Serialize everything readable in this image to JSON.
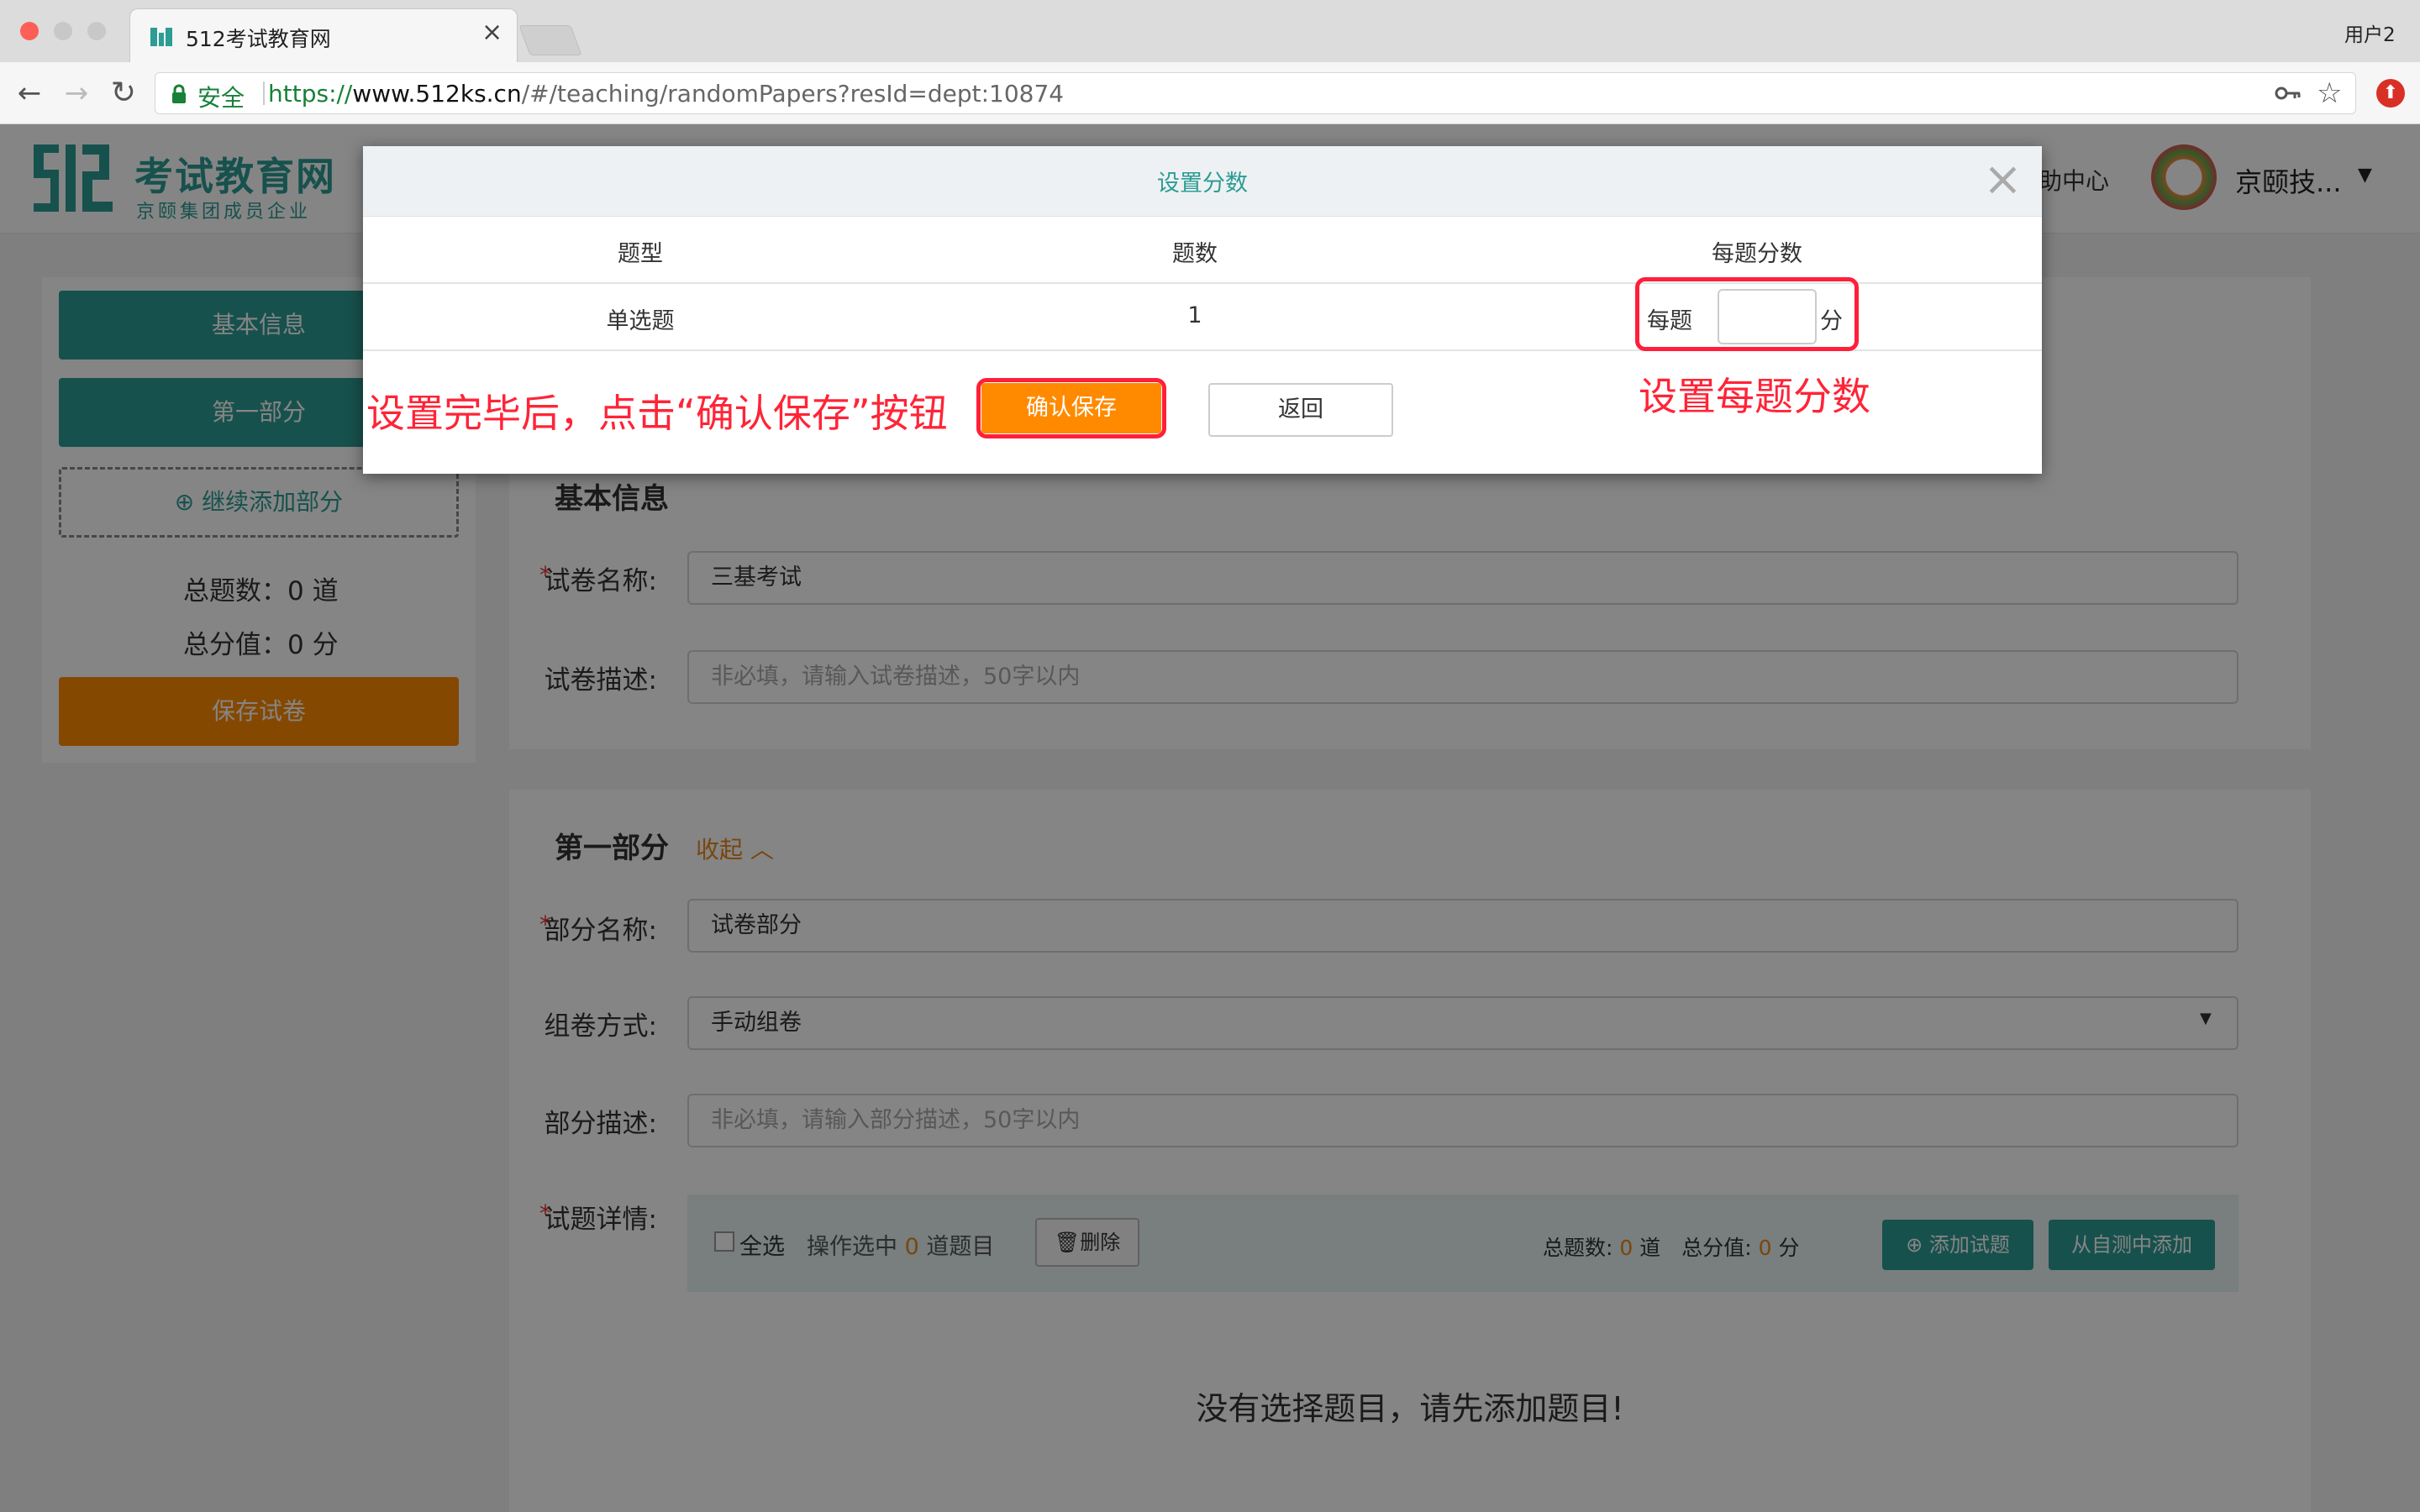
{
  "browser": {
    "tab_title": "512考试教育网",
    "tab_close": "×",
    "profile": "用户2",
    "url_secure": "安全",
    "url_scheme": "https://",
    "url_host": "www.512ks.cn",
    "url_path": "/#/teaching/randomPapers?resId=dept:10874"
  },
  "header": {
    "logo_mark": "512",
    "logo_title": "考试教育网",
    "logo_subtitle": "京颐集团成员企业",
    "help": "帮助中心",
    "user": "京颐技..."
  },
  "sidebar": {
    "basic_info": "基本信息",
    "part1": "第一部分",
    "add_part": "继续添加部分",
    "total_count_label": "总题数：",
    "total_count": "0",
    "total_count_unit": "道",
    "total_score_label": "总分值：",
    "total_score": "0",
    "total_score_unit": "分",
    "save_paper": "保存试卷"
  },
  "basic": {
    "section_title": "基本信息",
    "name_label": "试卷名称:",
    "name_value": "三基考试",
    "desc_label": "试卷描述:",
    "desc_placeholder": "非必填，请输入试卷描述，50字以内"
  },
  "part": {
    "section_title": "第一部分",
    "collapse": "收起",
    "name_label": "部分名称:",
    "name_value": "试卷部分",
    "mode_label": "组卷方式:",
    "mode_value": "手动组卷",
    "desc_label": "部分描述:",
    "desc_placeholder": "非必填，请输入部分描述，50字以内",
    "detail_label": "试题详情:",
    "select_all": "全选",
    "op_selected": "操作选中",
    "selected_count": "0",
    "selected_unit": "道题目",
    "delete": "删除",
    "total_count_label": "总题数:",
    "total_count": "0",
    "total_count_unit": "道",
    "total_score_label": "总分值:",
    "total_score": "0",
    "total_score_unit": "分",
    "add_question": "添加试题",
    "add_from_self_test": "从自测中添加",
    "empty_message": "没有选择题目，请先添加题目!"
  },
  "modal": {
    "title": "设置分数",
    "close": "×",
    "columns": [
      "题型",
      "题数",
      "每题分数"
    ],
    "row": {
      "type": "单选题",
      "count": "1",
      "per_label": "每题",
      "per_value": "",
      "unit": "分"
    },
    "confirm": "确认保存",
    "back": "返回"
  },
  "annotations": {
    "left": "设置完毕后，点击“确认保存”按钮",
    "right": "设置每题分数"
  },
  "colors": {
    "teal": "#2c9c94",
    "orange": "#ff8a00",
    "annotation_red": "#ff2437"
  }
}
